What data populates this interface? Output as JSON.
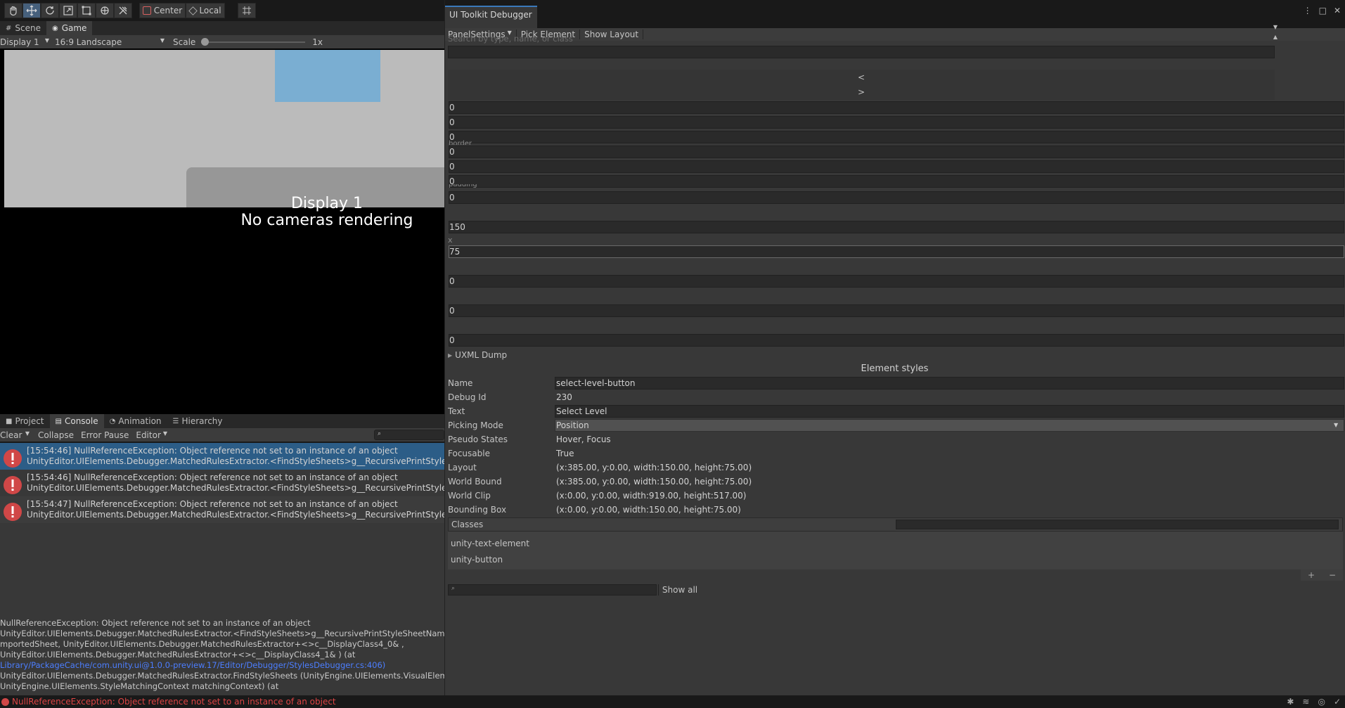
{
  "toolbar": {
    "pivot_label": "Center",
    "space_label": "Local"
  },
  "game": {
    "tabs": [
      {
        "label": "Scene",
        "icon": "scene-icon"
      },
      {
        "label": "Game",
        "icon": "game-icon"
      }
    ],
    "display": "Display 1",
    "aspect": "16:9 Landscape",
    "scale_label": "Scale",
    "scale_value": "1x",
    "message_line1": "Display 1",
    "message_line2": "No cameras rendering"
  },
  "bottom_panel": {
    "tabs": [
      {
        "label": "Project"
      },
      {
        "label": "Console"
      },
      {
        "label": "Animation"
      },
      {
        "label": "Hierarchy"
      }
    ],
    "console": {
      "clear": "Clear",
      "collapse": "Collapse",
      "error_pause": "Error Pause",
      "editor": "Editor",
      "entries": [
        {
          "line1": "[15:54:46] NullReferenceException: Object reference not set to an instance of an object",
          "line2": "UnityEditor.UIElements.Debugger.MatchedRulesExtractor.<FindStyleSheets>g__RecursivePrintStyleSheetN"
        },
        {
          "line1": "[15:54:46] NullReferenceException: Object reference not set to an instance of an object",
          "line2": "UnityEditor.UIElements.Debugger.MatchedRulesExtractor.<FindStyleSheets>g__RecursivePrintStyleSheetN"
        },
        {
          "line1": "[15:54:47] NullReferenceException: Object reference not set to an instance of an object",
          "line2": "UnityEditor.UIElements.Debugger.MatchedRulesExtractor.<FindStyleSheets>g__RecursivePrintStyleSheetN"
        }
      ],
      "detail": {
        "l1": "NullReferenceException: Object reference not set to an instance of an object",
        "l2": "UnityEditor.UIElements.Debugger.MatchedRulesExtractor.<FindStyleSheets>g__RecursivePrintStyleSheetNames|",
        "l3": "mportedSheet, UnityEditor.UIElements.Debugger.MatchedRulesExtractor+<>c__DisplayClass4_0& ,",
        "l4": "UnityEditor.UIElements.Debugger.MatchedRulesExtractor+<>c__DisplayClass4_1& ) (at",
        "l5": "Library/PackageCache/com.unity.ui@1.0.0-preview.17/Editor/Debugger/StylesDebugger.cs:406)",
        "l6": "UnityEditor.UIElements.Debugger.MatchedRulesExtractor.FindStyleSheets (UnityEngine.UIElements.VisualElement cursor,",
        "l7": "UnityEngine.UIElements.StyleMatchingContext matchingContext) (at"
      }
    }
  },
  "status": {
    "message": "NullReferenceException: Object reference not set to an instance of an object"
  },
  "debugger": {
    "title": "UI Toolkit Debugger",
    "panel_settings": "PanelSettings",
    "pick_element": "Pick Element",
    "show_layout": "Show Layout",
    "search_placeholder": "Search by type, name, or class",
    "prev": "<",
    "next": ">",
    "layout_values": [
      "0",
      "0",
      "0",
      "0",
      "0",
      "0",
      "0",
      "150",
      "75",
      "0",
      "0",
      "0"
    ],
    "partial_labels": [
      "border",
      "padding",
      "x"
    ],
    "uxml_dump": "UXML Dump",
    "element_styles": "Element styles",
    "props": [
      {
        "label": "Name",
        "value": "select-level-button"
      },
      {
        "label": "Debug Id",
        "value": "230"
      },
      {
        "label": "Text",
        "value": "Select Level"
      },
      {
        "label": "Picking Mode",
        "value": "Position"
      },
      {
        "label": "Pseudo States",
        "value": "Hover, Focus"
      },
      {
        "label": "Focusable",
        "value": "True"
      },
      {
        "label": "Layout",
        "value": "(x:385.00, y:0.00, width:150.00, height:75.00)"
      },
      {
        "label": "World Bound",
        "value": "(x:385.00, y:0.00, width:150.00, height:75.00)"
      },
      {
        "label": "World Clip",
        "value": "(x:0.00, y:0.00, width:919.00, height:517.00)"
      },
      {
        "label": "Bounding Box",
        "value": "(x:0.00, y:0.00, width:150.00, height:75.00)"
      }
    ],
    "classes_label": "Classes",
    "classes": [
      "unity-text-element",
      "unity-button"
    ],
    "add": "+",
    "remove": "−",
    "show_all": "Show all"
  }
}
